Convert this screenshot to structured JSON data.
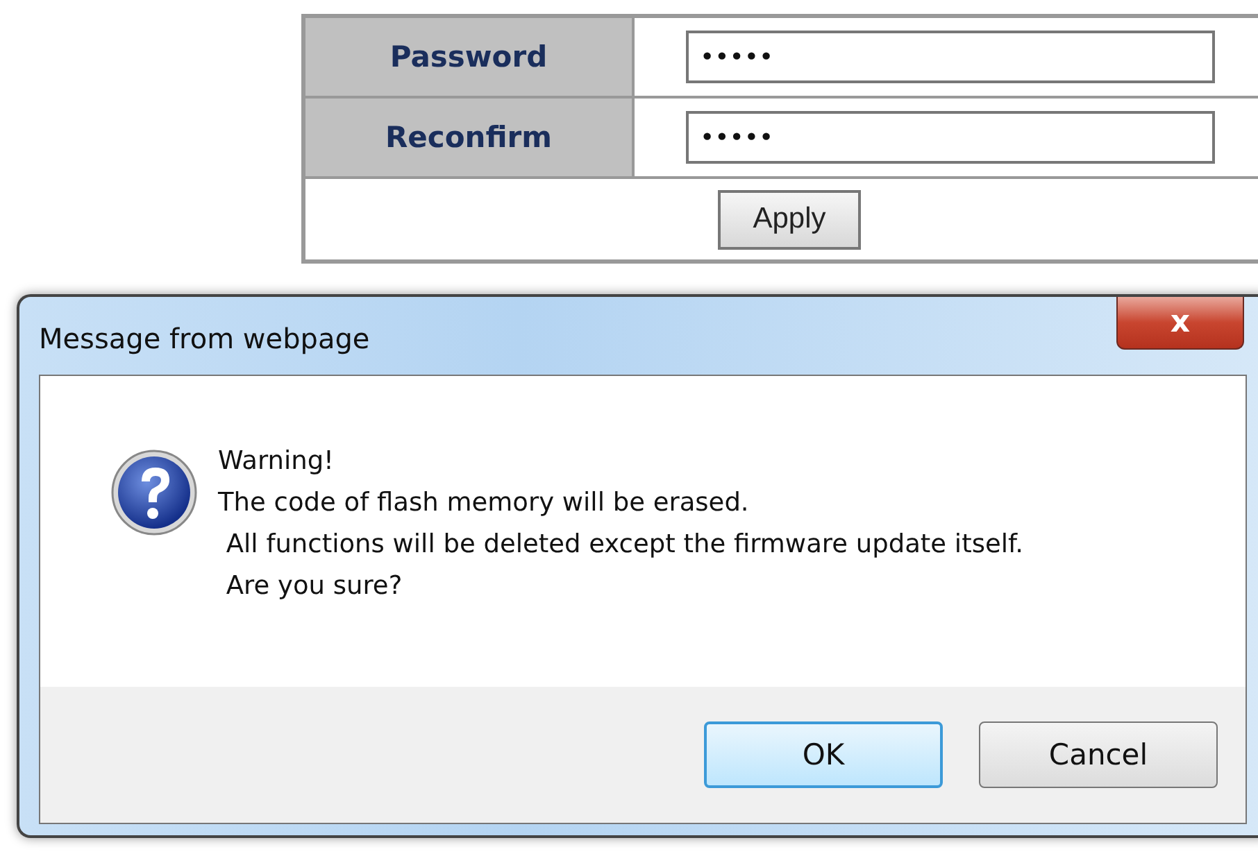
{
  "form": {
    "rows": [
      {
        "label": "Password",
        "value": "•••••"
      },
      {
        "label": "Reconfirm",
        "value": "•••••"
      }
    ],
    "apply_button": "Apply"
  },
  "dialog": {
    "title": "Message from webpage",
    "close": "x",
    "message": [
      "Warning!",
      "The code of flash memory will be erased.",
      " All functions will be deleted except the firmware update itself.",
      " Are you sure?"
    ],
    "buttons": [
      {
        "label": "OK",
        "focused": true
      },
      {
        "label": "Cancel",
        "focused": false
      }
    ]
  }
}
